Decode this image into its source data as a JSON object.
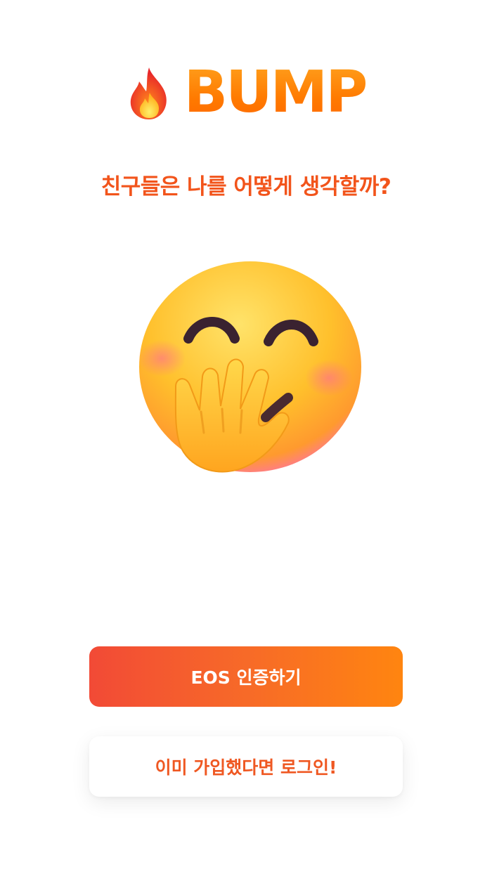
{
  "brand": {
    "logo_icon": "fire-icon",
    "name": "BUMP"
  },
  "headline": "친구들은 나를 어떻게 생각할까?",
  "illustration": {
    "icon": "hand-over-mouth-emoji"
  },
  "buttons": {
    "primary_label": "EOS 인증하기",
    "secondary_label": "이미 가입했다면 로그인!"
  },
  "colors": {
    "accent": "#f2541b",
    "primary_gradient_start": "#f24a36",
    "primary_gradient_end": "#ff8510",
    "brand_orange": "#ff8a00"
  }
}
